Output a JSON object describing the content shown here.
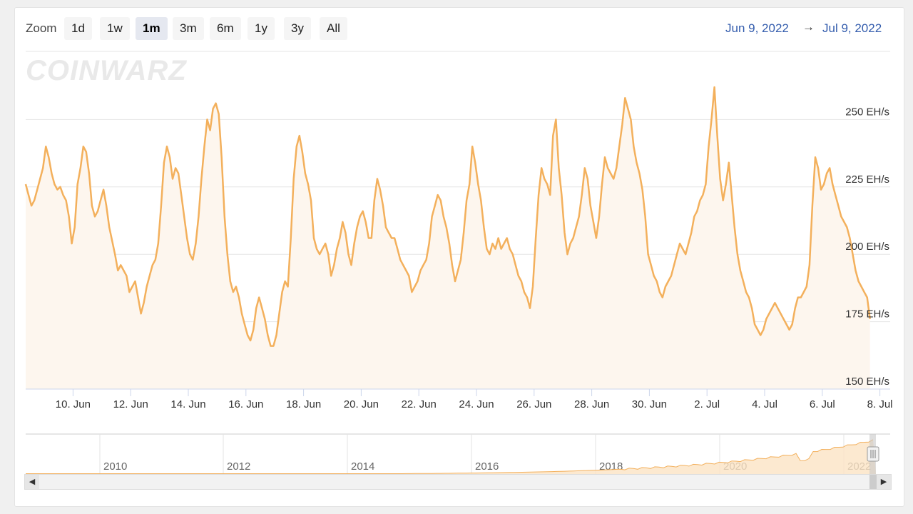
{
  "zoom": {
    "label": "Zoom",
    "buttons": [
      "1d",
      "1w",
      "1m",
      "3m",
      "6m",
      "1y",
      "3y",
      "All"
    ],
    "active": "1m"
  },
  "range": {
    "from": "Jun 9, 2022",
    "arrow": "→",
    "to": "Jul 9, 2022"
  },
  "watermark": "COINWARZ",
  "colors": {
    "line": "#f3b05c",
    "fill": "#fdf6ee",
    "navigator_fill": "#fbe3c4",
    "grid": "#e6e6e6",
    "range_text": "#335cad"
  },
  "chart_data": {
    "type": "line",
    "x_ticks": [
      "10. Jun",
      "12. Jun",
      "14. Jun",
      "16. Jun",
      "18. Jun",
      "20. Jun",
      "22. Jun",
      "24. Jun",
      "26. Jun",
      "28. Jun",
      "30. Jun",
      "2. Jul",
      "4. Jul",
      "6. Jul",
      "8. Jul"
    ],
    "y_ticks": [
      "150 EH/s",
      "175 EH/s",
      "200 EH/s",
      "225 EH/s",
      "250 EH/s"
    ],
    "ylim": [
      150,
      262
    ],
    "series": [
      {
        "x_start_day": 9.0,
        "step_days": 0.1,
        "values": [
          226,
          222,
          218,
          220,
          224,
          228,
          232,
          240,
          236,
          230,
          226,
          224,
          225,
          222,
          220,
          214,
          204,
          210,
          226,
          232,
          240,
          238,
          230,
          218,
          214,
          216,
          220,
          224,
          218,
          210,
          205,
          200,
          194,
          196,
          194,
          192,
          186,
          188,
          190,
          184,
          178,
          182,
          188,
          192,
          196,
          198,
          204,
          218,
          234,
          240,
          236,
          228,
          232,
          230,
          222,
          214,
          206,
          200,
          198,
          204,
          214,
          228,
          240,
          250,
          246,
          254,
          256,
          252,
          236,
          214,
          200,
          190,
          186,
          188,
          184,
          178,
          174,
          170,
          168,
          172,
          180,
          184,
          180,
          176,
          170,
          166,
          166,
          170,
          178,
          186,
          190,
          188,
          206,
          228,
          240,
          244,
          238,
          230,
          226,
          220,
          206,
          202,
          200,
          202,
          204,
          200,
          192,
          196,
          202,
          206,
          212,
          208,
          200,
          196,
          204,
          210,
          214,
          216,
          212,
          206,
          206,
          220,
          228,
          224,
          218,
          210,
          208,
          206,
          206,
          202,
          198,
          196,
          194,
          192,
          186,
          188,
          190,
          194,
          196,
          198,
          204,
          214,
          218,
          222,
          220,
          214,
          210,
          204,
          196,
          190,
          194,
          198,
          208,
          220,
          226,
          240,
          234,
          226,
          220,
          210,
          202,
          200,
          204,
          202,
          206,
          202,
          204,
          206,
          202,
          200,
          196,
          192,
          190,
          186,
          184,
          180,
          188,
          206,
          222,
          232,
          228,
          226,
          222,
          244,
          250,
          232,
          222,
          208,
          200,
          204,
          206,
          210,
          214,
          222,
          232,
          228,
          218,
          212,
          206,
          214,
          226,
          236,
          232,
          230,
          228,
          232,
          240,
          248,
          258,
          254,
          250,
          240,
          234,
          230,
          224,
          214,
          200,
          196,
          192,
          190,
          186,
          184,
          188,
          190,
          192,
          196,
          200,
          204,
          202,
          200,
          204,
          208,
          214,
          216,
          220,
          222,
          226,
          240,
          250,
          262,
          244,
          228,
          220,
          226,
          234,
          222,
          210,
          200,
          194,
          190,
          186,
          184,
          180,
          174,
          172,
          170,
          172,
          176,
          178,
          180,
          182,
          180,
          178,
          176,
          174,
          172,
          174,
          180,
          184,
          184,
          186,
          188,
          196,
          218,
          236,
          232,
          224,
          226,
          230,
          232,
          226,
          222,
          218,
          214,
          212,
          210,
          206,
          200,
          194,
          190,
          188,
          186,
          184,
          176
        ]
      }
    ],
    "navigator": {
      "x_labels": [
        "2010",
        "2012",
        "2014",
        "2016",
        "2018",
        "2020",
        "2022"
      ]
    }
  }
}
